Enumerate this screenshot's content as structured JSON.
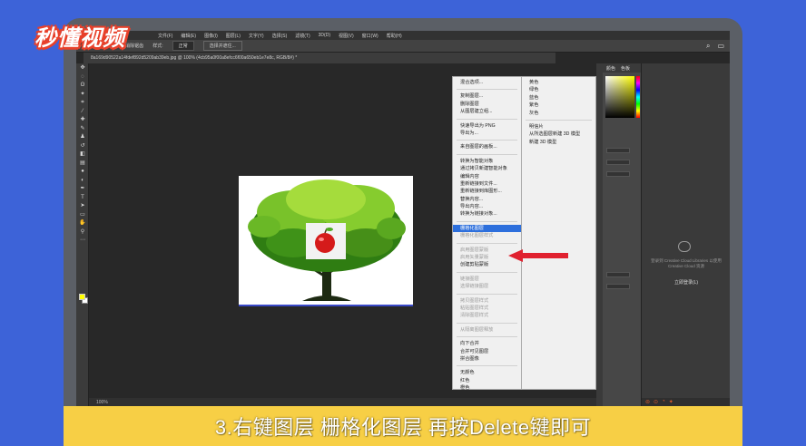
{
  "logo": {
    "text": "秒懂视频"
  },
  "app": {
    "menu": [
      "文件(F)",
      "编辑(E)",
      "图像(I)",
      "图层(L)",
      "文字(Y)",
      "选择(S)",
      "滤镜(T)",
      "3D(D)",
      "视图(V)",
      "窗口(W)",
      "帮助(H)"
    ],
    "options": {
      "prefix": "0 像素",
      "anti_alias": "消除锯齿",
      "style_label": "样式:",
      "style_value": "正常",
      "mask_button": "选择并遮住..."
    },
    "document_tab": "8a169d90522a14fdef892d5209ab39eb.jpg @ 100% (4cb95a0f00a8efcc6f00a650eb1e7e8c, RGB/8#) *",
    "status": "100%"
  },
  "context_menu": {
    "items": [
      {
        "label": "混合选项...",
        "state": "normal",
        "sep_after": false
      },
      {
        "label": "",
        "state": "sep",
        "sep_after": false
      },
      {
        "label": "复制图层...",
        "state": "normal"
      },
      {
        "label": "删除图层",
        "state": "normal"
      },
      {
        "label": "从图层建立组...",
        "state": "normal"
      },
      {
        "label": "",
        "state": "sep"
      },
      {
        "label": "快速导出为 PNG",
        "state": "normal"
      },
      {
        "label": "导出为...",
        "state": "normal"
      },
      {
        "label": "",
        "state": "sep"
      },
      {
        "label": "来自图层的画板...",
        "state": "normal"
      },
      {
        "label": "",
        "state": "sep"
      },
      {
        "label": "转换为智能对象",
        "state": "normal"
      },
      {
        "label": "通过拷贝新建智能对象",
        "state": "normal"
      },
      {
        "label": "编辑内容",
        "state": "normal"
      },
      {
        "label": "重新链接到文件...",
        "state": "normal"
      },
      {
        "label": "重新链接到库图形...",
        "state": "normal"
      },
      {
        "label": "替换内容...",
        "state": "normal"
      },
      {
        "label": "导出内容...",
        "state": "normal"
      },
      {
        "label": "转换为链接对象...",
        "state": "normal"
      },
      {
        "label": "",
        "state": "sep"
      },
      {
        "label": "栅格化图层",
        "state": "highlight"
      },
      {
        "label": "栅格化图层样式",
        "state": "disabled"
      },
      {
        "label": "",
        "state": "sep"
      },
      {
        "label": "启用图层蒙版",
        "state": "disabled"
      },
      {
        "label": "启用矢量蒙版",
        "state": "disabled"
      },
      {
        "label": "创建剪贴蒙版",
        "state": "normal"
      },
      {
        "label": "",
        "state": "sep"
      },
      {
        "label": "链接图层",
        "state": "disabled"
      },
      {
        "label": "选择链接图层",
        "state": "disabled"
      },
      {
        "label": "",
        "state": "sep"
      },
      {
        "label": "拷贝图层样式",
        "state": "disabled"
      },
      {
        "label": "粘贴图层样式",
        "state": "disabled"
      },
      {
        "label": "清除图层样式",
        "state": "disabled"
      },
      {
        "label": "",
        "state": "sep"
      },
      {
        "label": "从隔离图层释放",
        "state": "disabled"
      },
      {
        "label": "",
        "state": "sep"
      },
      {
        "label": "向下合并",
        "state": "normal"
      },
      {
        "label": "合并可见图层",
        "state": "normal"
      },
      {
        "label": "拼合图像",
        "state": "normal"
      },
      {
        "label": "",
        "state": "sep"
      },
      {
        "label": "无颜色",
        "state": "normal"
      },
      {
        "label": "红色",
        "state": "normal"
      },
      {
        "label": "橙色",
        "state": "normal"
      }
    ]
  },
  "submenu": {
    "items": [
      "黄色",
      "绿色",
      "蓝色",
      "紫色",
      "灰色",
      "",
      "明信片",
      "从所选图层新建 3D 模型",
      "新建 3D 模型"
    ]
  },
  "panels": {
    "tabs": [
      "颜色",
      "色板"
    ],
    "cc_text": "登录到 Creative Cloud Libraries 以使用 Creative Cloud 资源",
    "cc_link": "立即登录(L)"
  },
  "caption": {
    "text": "3.右键图层 栅格化图层 再按Delete键即可"
  },
  "colors": {
    "highlight": "#2d6fdc",
    "arrow": "#e0212f",
    "caption_bg": "#f7cf45",
    "frame_bg": "#3d63d8"
  }
}
